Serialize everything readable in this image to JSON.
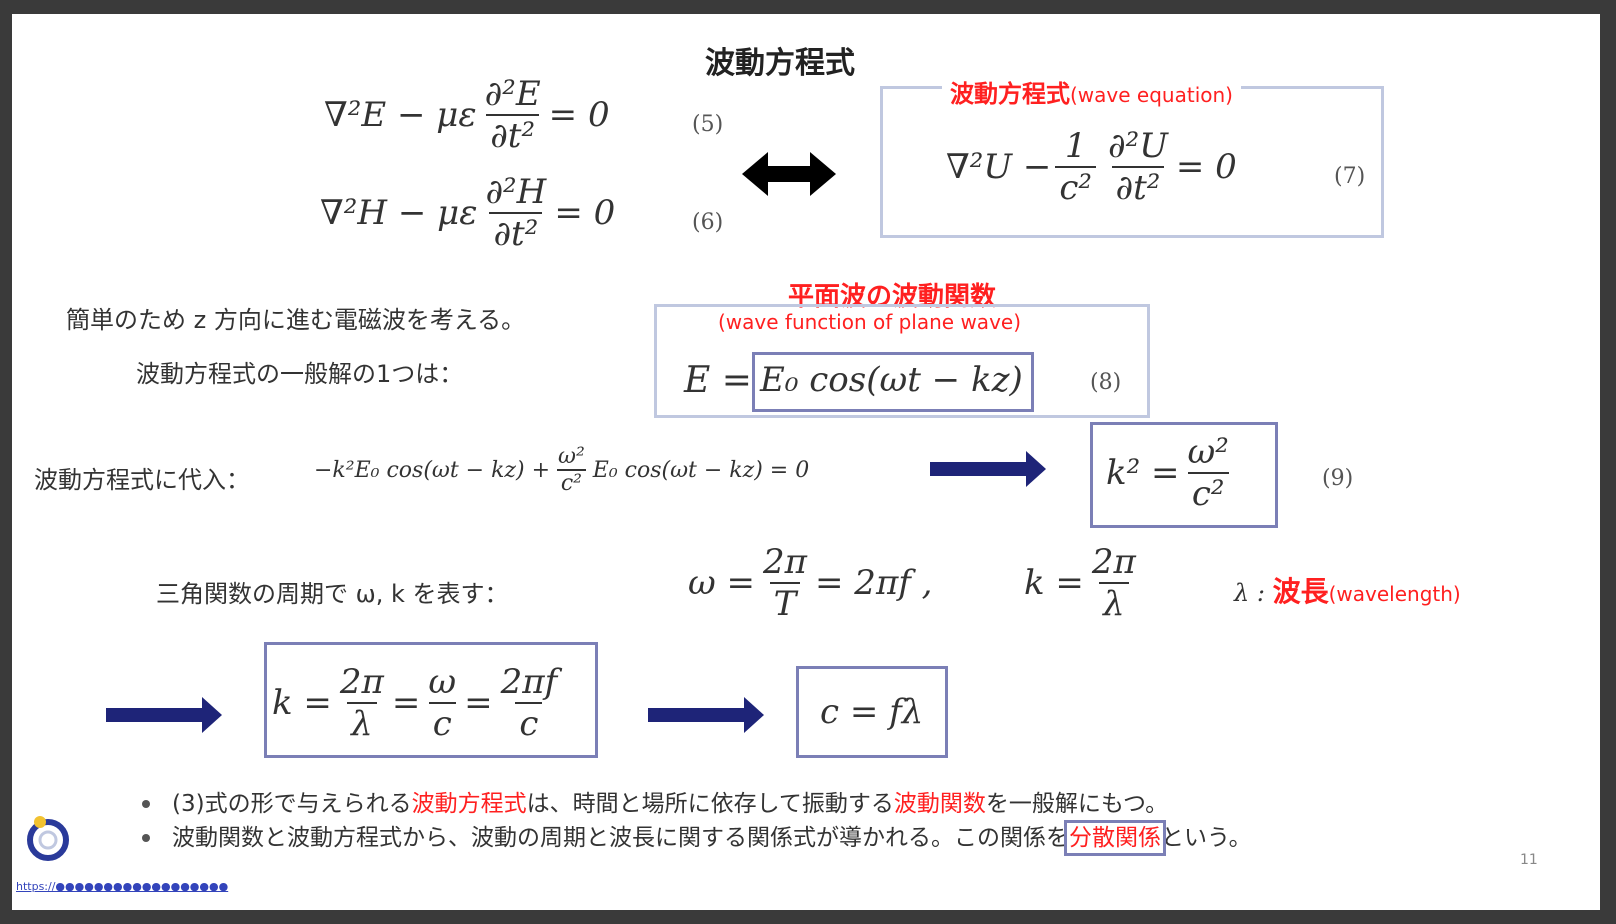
{
  "title": "波動方程式",
  "eq5": {
    "lhs": "∇²E − με",
    "num": "∂²E",
    "den": "∂t²",
    "rhs": "= 0",
    "num_label": "(5)"
  },
  "eq6": {
    "lhs": "∇²H − με",
    "num": "∂²H",
    "den": "∂t²",
    "rhs": "= 0",
    "num_label": "(6)"
  },
  "wave_box": {
    "title_jp": "波動方程式",
    "title_en": "(wave equation)",
    "lhs": "∇²U −",
    "frac1_num": "1",
    "frac1_den": "c²",
    "frac2_num": "∂²U",
    "frac2_den": "∂t²",
    "rhs": "= 0",
    "num_label": "(7)"
  },
  "plane_wave": {
    "title_jp": "平面波の波動関数",
    "title_en": "(wave function of plane wave)",
    "lhs": "E =",
    "expr": "E₀ cos(ωt − kz)",
    "num_label": "(8)"
  },
  "intro_line1": "簡単のため z 方向に進む電磁波を考える。",
  "intro_line2": "波動方程式の一般解の1つは：",
  "subst_label": "波動方程式に代入：",
  "subst_expr_a": "−k²E₀ cos(ωt − kz) +",
  "subst_frac_num": "ω²",
  "subst_frac_den": "c²",
  "subst_expr_b": "E₀ cos(ωt − kz) = 0",
  "eq9": {
    "lhs": "k² =",
    "num": "ω²",
    "den": "c²",
    "num_label": "(9)"
  },
  "trig_label": "三角関数の周期で ω, k を表す：",
  "omega_eq": {
    "lhs": "ω =",
    "num": "2π",
    "den": "T",
    "rhs": "= 2πf ,"
  },
  "k_eq": {
    "lhs": "k =",
    "num": "2π",
    "den": "λ"
  },
  "lambda_note": {
    "sym": "λ :",
    "jp": "波長",
    "en": "(wavelength)"
  },
  "chain": {
    "k": "k =",
    "f1_num": "2π",
    "f1_den": "λ",
    "f2_num": "ω",
    "f2_den": "c",
    "f3_num": "2πf",
    "f3_den": "c"
  },
  "cfl": "c = fλ",
  "bullets": [
    {
      "a": "(3)式の形で与えられる",
      "b": "波動方程式",
      "c": "は、時間と場所に依存して振動する",
      "d": "波動関数",
      "e": "を一般解にもつ。"
    },
    {
      "a": "波動関数と波動方程式から、波動の周期と波長に関する関係式が導かれる。この関係を",
      "b": "分散関係",
      "c": "という。"
    }
  ],
  "page_number": "11",
  "footer_link": "https://●●●●●●●●●●●●●●●●●●"
}
